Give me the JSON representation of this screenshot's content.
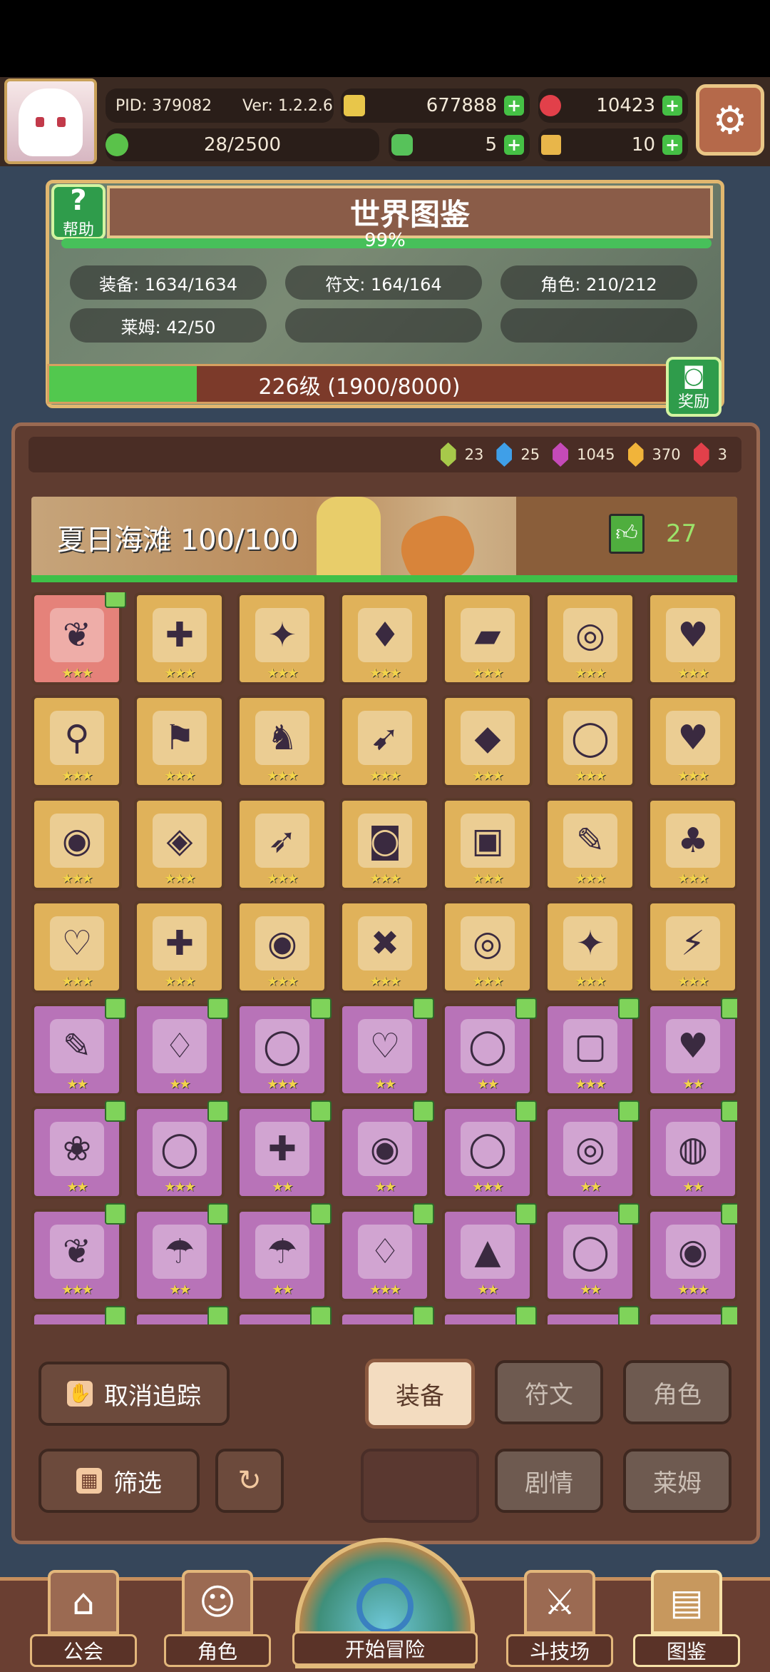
{
  "header": {
    "pid": "PID: 379082",
    "version": "Ver: 1.2.2.6",
    "gold": "677888",
    "gems": "10423",
    "stamina": "28/2500",
    "clover": "5",
    "keys": "10"
  },
  "world": {
    "help_label": "帮助",
    "title": "世界图鉴",
    "percent": "99%",
    "stats": {
      "equipment": "装备: 1634/1634",
      "rune": "符文: 164/164",
      "role": "角色: 210/212",
      "slime": "莱姆: 42/50"
    },
    "level_text": "226级 (1900/8000)",
    "xp_progress": 0.2375,
    "reward_label": "奖励"
  },
  "gems_bar": [
    {
      "color": "#a7c94a",
      "count": "23"
    },
    {
      "color": "#3f9fe8",
      "count": "25"
    },
    {
      "color": "#c54ab8",
      "count": "1045"
    },
    {
      "color": "#f1b43a",
      "count": "370"
    },
    {
      "color": "#e2404a",
      "count": "3"
    }
  ],
  "banner": {
    "title": "夏日海滩 100/100",
    "likes": "27"
  },
  "controls": {
    "untrack": "取消追踪",
    "filter": "筛选",
    "equipment": "装备",
    "rune": "符文",
    "role": "角色",
    "story": "剧情",
    "slime": "莱姆"
  },
  "nav": {
    "guild": "公会",
    "role": "角色",
    "adventure": "开始冒险",
    "arena": "斗技场",
    "codex": "图鉴"
  }
}
